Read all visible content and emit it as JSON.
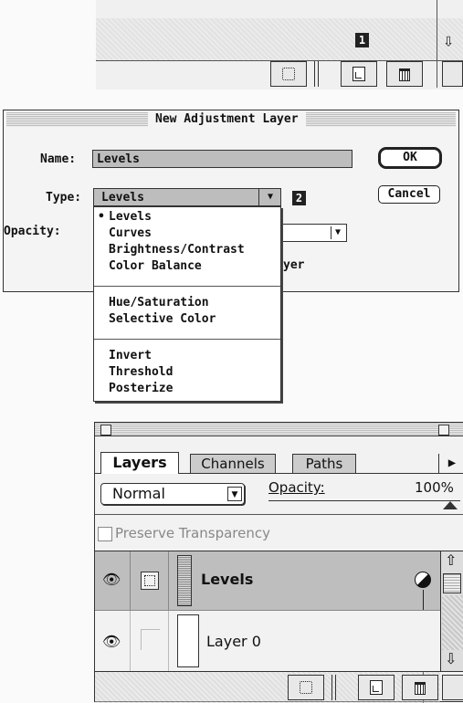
{
  "top_panel": {
    "step_badge": "1"
  },
  "dialog": {
    "title": "New Adjustment Layer",
    "name_label": "Name:",
    "name_value": "Levels",
    "type_label": "Type:",
    "type_value": "Levels",
    "opacity_label": "Opacity:",
    "ok_label": "OK",
    "cancel_label": "Cancel",
    "step_badge": "2",
    "partial_text": "yer",
    "menu_groups": [
      [
        "Levels",
        "Curves",
        "Brightness/Contrast",
        "Color Balance"
      ],
      [
        "Hue/Saturation",
        "Selective Color"
      ],
      [
        "Invert",
        "Threshold",
        "Posterize"
      ]
    ],
    "selected_marker": "•"
  },
  "layers_palette": {
    "tabs": [
      "Layers",
      "Channels",
      "Paths"
    ],
    "blend_mode": "Normal",
    "opacity_label": "Opacity:",
    "opacity_value": "100%",
    "preserve_label": "Preserve Transparency",
    "layers": [
      {
        "name": "Levels",
        "type": "adjustment"
      },
      {
        "name": "Layer 0",
        "type": "normal"
      }
    ]
  }
}
